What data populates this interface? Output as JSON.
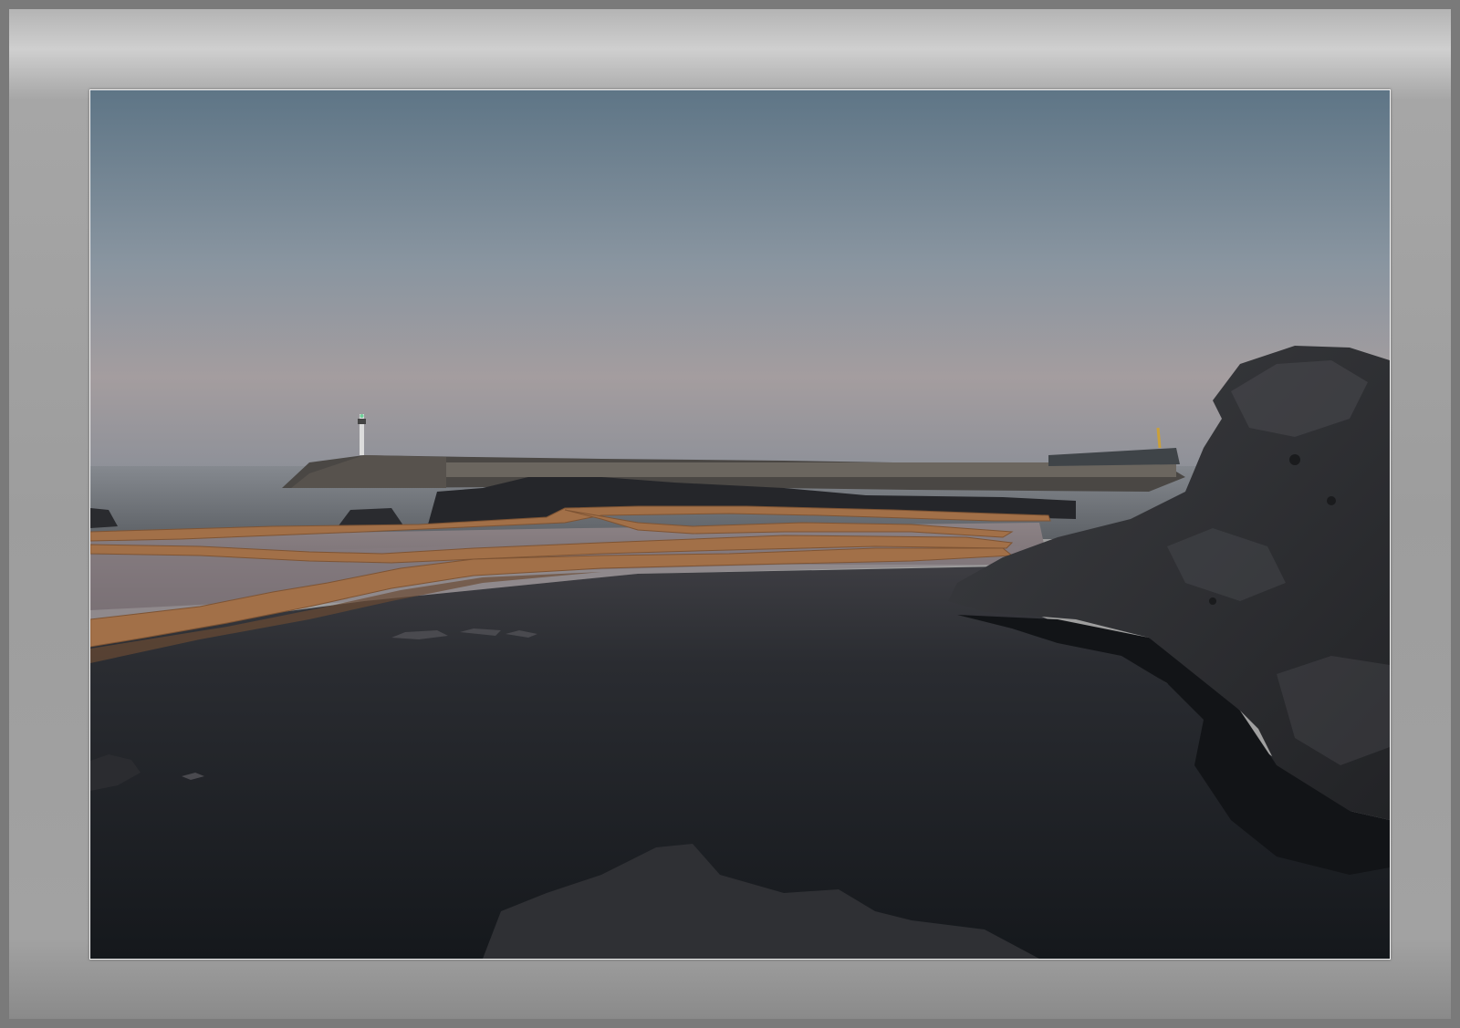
{
  "photo": {
    "subject": "coastal-salt-pans-at-dusk",
    "colors": {
      "sky_top": "#5e7586",
      "sky_mid": "#8b95a0",
      "sky_horizon": "#a59e9f",
      "sea": "#6d7175",
      "pool_dark": "#1d2126",
      "ridge_orange": "#a27048",
      "rock_dark": "#2b2c2f",
      "frame_gray": "#a0a0a0"
    }
  }
}
